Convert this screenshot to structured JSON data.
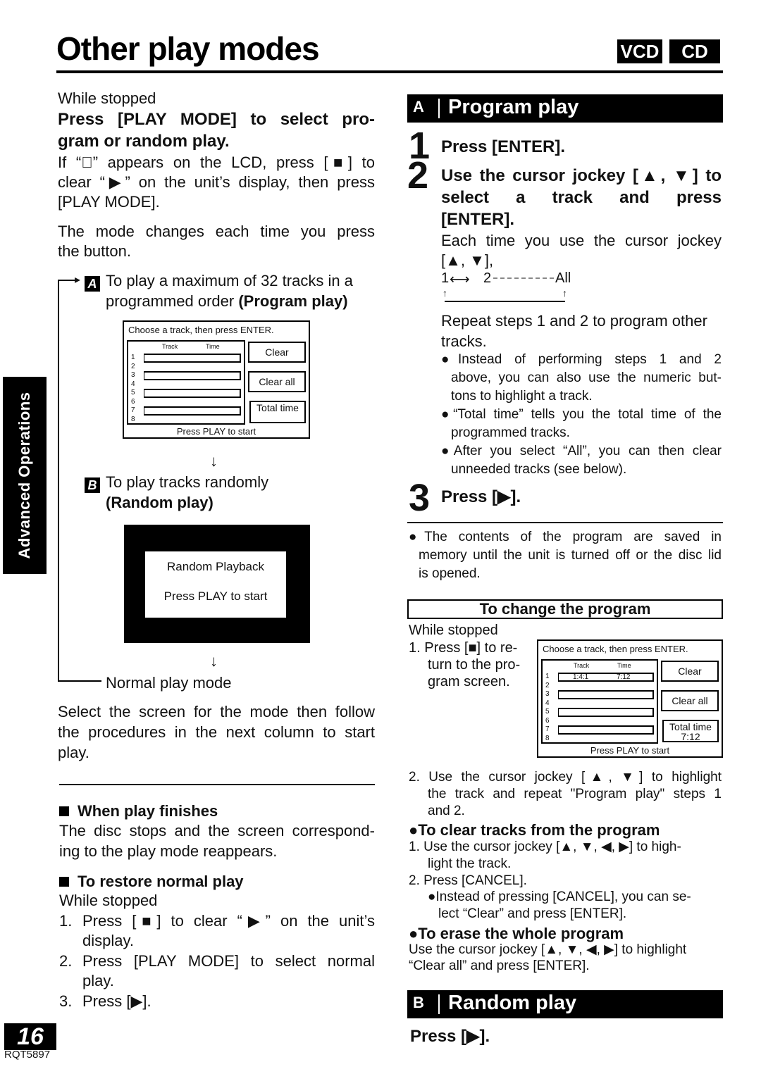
{
  "header": {
    "title": "Other play modes",
    "badges": [
      "VCD",
      "CD"
    ]
  },
  "side_tab": {
    "label": "Advanced Operations"
  },
  "left": {
    "while_stopped": "While stopped",
    "instruction_line1": "Press [PLAY MODE] to select pro-",
    "instruction_line2": "gram or random play.",
    "note_line1": "If “⃠” appears on the LCD, press [■] to",
    "note_line2": "clear “▶” on the unit’s display, then press",
    "note_line3": "[PLAY MODE].",
    "mode_changes_line1": "The mode changes each time you press",
    "mode_changes_line2": "the button.",
    "option_a": {
      "key": "A",
      "line1": "To play a maximum of 32 tracks in a",
      "line2_plain": "programmed order ",
      "line2_bold": "(Program play)"
    },
    "program_screen": {
      "header": "Choose a track, then press ENTER.",
      "col_track": "Track",
      "col_time": "Time",
      "row_numbers": [
        "1",
        "2",
        "3",
        "4",
        "5",
        "6",
        "7",
        "8"
      ],
      "btn_clear": "Clear",
      "btn_clear_all": "Clear all",
      "btn_total_time": "Total time",
      "footer": "Press PLAY to start"
    },
    "arrow_down": "↓",
    "option_b": {
      "key": "B",
      "line1": "To play tracks randomly",
      "line2_bold": "(Random play)"
    },
    "random_screen": {
      "line1": "Random Playback",
      "line2": "Press PLAY to start"
    },
    "normal_play_mode": "Normal play mode",
    "select_screen_line1": "Select the screen for the mode then follow",
    "select_screen_line2": "the procedures in the next column to start",
    "select_screen_line3": "play.",
    "when_finishes": {
      "heading": "When play finishes",
      "line1": "The disc stops and the screen correspond-",
      "line2": "ing to the play mode reappears."
    },
    "restore": {
      "heading": "To restore normal play",
      "while_stopped": "While stopped",
      "steps": [
        {
          "num": "1.",
          "line1": "Press [■] to clear “▶” on the unit’s",
          "line2": "display."
        },
        {
          "num": "2.",
          "line1": "Press [PLAY MODE] to select normal",
          "line2": "play."
        },
        {
          "num": "3.",
          "line1": "Press [▶].",
          "line2": ""
        }
      ]
    }
  },
  "right": {
    "program_play": {
      "letter": "A",
      "title": "Program play",
      "step1_num": "1",
      "step1": "Press [ENTER].",
      "step2_num": "2",
      "step2_line1": "Use the cursor jockey [▲, ▼] to",
      "step2_line2": "select  a  track  and  press",
      "step2_line3": "[ENTER].",
      "each_time_line1": "Each time you use the cursor jockey",
      "each_time_line2": "[▲, ▼],",
      "cycle": {
        "a": "1",
        "b": "2",
        "c": "All"
      },
      "repeat_line1": "Repeat steps 1 and 2 to program other",
      "repeat_line2": "tracks.",
      "bullets": [
        {
          "line1": "●Instead of performing steps 1 and 2",
          "line2": "above, you can also use the numeric but-",
          "line3": "tons to highlight a track."
        },
        {
          "line1": "●“Total time” tells you the total time of the",
          "line2": "programmed tracks.",
          "line3": ""
        },
        {
          "line1": "●After you select “All”, you can then clear",
          "line2": "unneeded tracks (see below).",
          "line3": ""
        }
      ],
      "step3_num": "3",
      "step3": "Press [▶].",
      "saved_line1": "●The contents of the program are saved in",
      "saved_line2": "memory until the unit is turned off or the disc lid",
      "saved_line3": "is opened."
    },
    "change_program": {
      "heading": "To change the program",
      "while_stopped": "While stopped",
      "step1_line1": "1.  Press [■] to re-",
      "step1_line2": "turn to the pro-",
      "step1_line3": "gram screen.",
      "screen": {
        "header": "Choose a track, then press ENTER.",
        "col_track": "Track",
        "col_time": "Time",
        "row_numbers": [
          "1",
          "2",
          "3",
          "4",
          "5",
          "6",
          "7",
          "8"
        ],
        "row1_track": "1:4:1",
        "row1_time": "7:12",
        "btn_clear": "Clear",
        "btn_clear_all": "Clear all",
        "btn_total_time": "Total time",
        "total_time_value": "7:12",
        "footer": "Press PLAY to start"
      },
      "step2_line1": "2.  Use the cursor jockey [▲, ▼] to highlight",
      "step2_line2": "the track and repeat \"Program play\" steps 1",
      "step2_line3": "and 2."
    },
    "clear_tracks": {
      "heading": "●To clear tracks from the program",
      "step1_line1": "1.  Use the cursor jockey [▲, ▼, ◀, ▶] to high-",
      "step1_line2": "light the track.",
      "step2": "2.  Press [CANCEL].",
      "note_line1": "●Instead of pressing [CANCEL], you can se-",
      "note_line2": "lect “Clear” and press [ENTER]."
    },
    "erase_program": {
      "heading": "●To erase the whole program",
      "line1": "Use the cursor jockey [▲, ▼, ◀, ▶] to highlight",
      "line2": "“Clear all” and press [ENTER]."
    },
    "random_play": {
      "letter": "B",
      "title": "Random play",
      "step": "Press [▶]."
    }
  },
  "footer": {
    "page_number": "16",
    "doc_id": "RQT5897"
  }
}
